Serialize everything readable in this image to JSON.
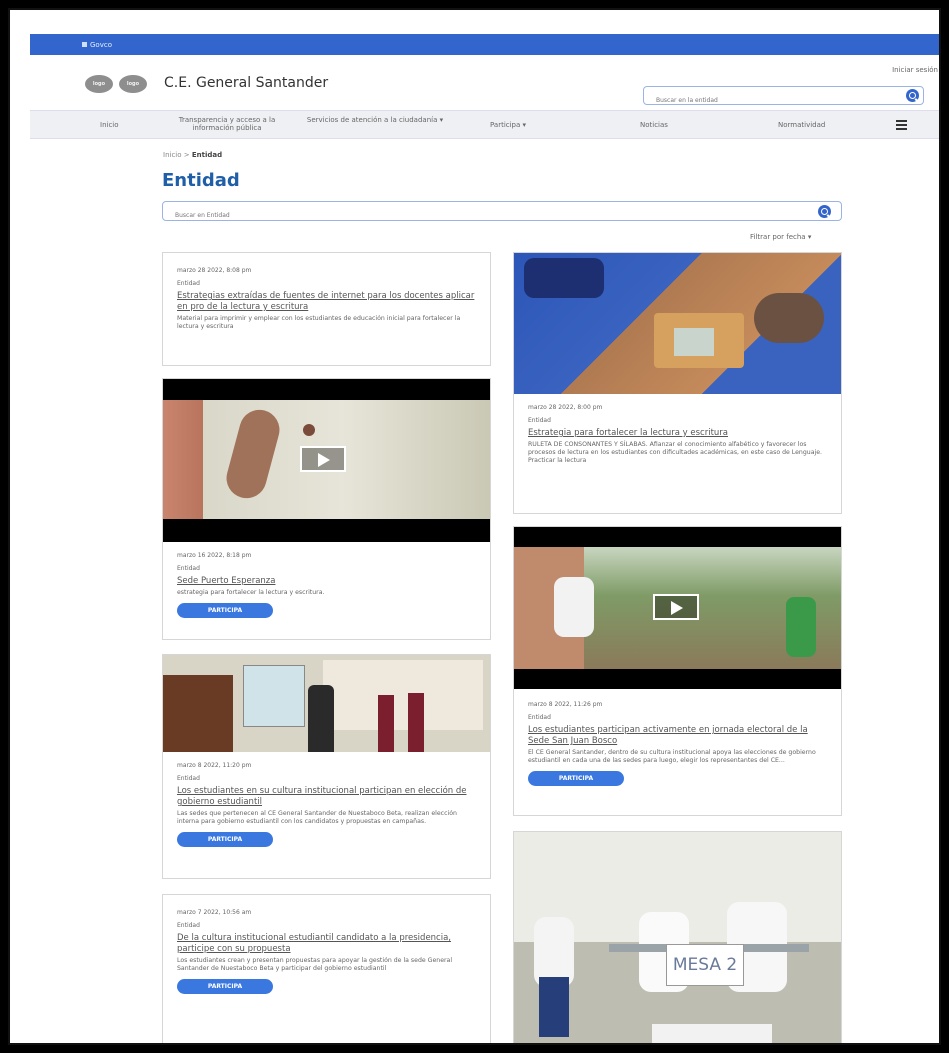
{
  "header": {
    "topbar_label": "Govco",
    "logo1": "logo",
    "logo2": "logo",
    "site_title": "C.E. General Santander",
    "login": "Iniciar sesión",
    "search_placeholder": "Buscar en la entidad"
  },
  "nav": {
    "items": [
      "Inicio",
      "Transparencia y acceso a la información pública",
      "Servicios de atención a la ciudadanía ▾",
      "Participa ▾",
      "Noticias",
      "Normatividad"
    ]
  },
  "breadcrumb": {
    "home": "Inicio",
    "sep": ">",
    "current": "Entidad"
  },
  "page": {
    "title": "Entidad",
    "search_placeholder": "Buscar en Entidad",
    "filter": "Filtrar por fecha ▾"
  },
  "cards": [
    {
      "date": "marzo 28 2022, 8:08 pm",
      "tag": "Entidad",
      "title": "Estrategias extraídas de fuentes de internet para los docentes aplicar en pro de la lectura y escritura",
      "desc": "Material para imprimir y emplear con los estudiantes de educación inicial para fortalecer la lectura y escritura"
    },
    {
      "date": "marzo 28 2022, 8:00 pm",
      "tag": "Entidad",
      "title": "Estrategia para fortalecer la lectura y escritura",
      "desc": "RULETA DE CONSONANTES Y SÍLABAS. Afianzar el conocimiento alfabético y favorecer los procesos de lectura en los estudiantes con dificultades académicas, en este caso de Lenguaje. Practicar la lectura"
    },
    {
      "date": "marzo 16 2022, 8:18 pm",
      "tag": "Entidad",
      "title": "Sede Puerto Esperanza",
      "desc": "estrategia para fortalecer la lectura y escritura.",
      "button": "PARTICIPA"
    },
    {
      "date": "marzo 8 2022, 11:26 pm",
      "tag": "Entidad",
      "title": "Los estudiantes participan activamente en jornada electoral de la Sede San Juan Bosco",
      "desc": "El CE General Santander, dentro de su cultura institucional apoya las elecciones de gobierno estudiantil en cada una de las sedes para luego, elegir los representantes del CE...",
      "button": "PARTICIPA"
    },
    {
      "date": "marzo 8 2022, 11:20 pm",
      "tag": "Entidad",
      "title": "Los estudiantes en su cultura institucional participan en elección de gobierno estudiantil",
      "desc": "Las sedes que pertenecen al CE General Santander de Nuestaboco Beta, realizan elección interna para gobierno estudiantil con los candidatos y propuestas en campañas.",
      "button": "PARTICIPA"
    },
    {
      "date": "marzo 7 2022, 10:56 am",
      "tag": "Entidad",
      "title": "De la cultura institucional estudiantil candidato a la presidencia, participe con su propuesta",
      "desc": "Los estudiantes crean y presentan propuestas para apoyar la gestión de la sede General Santander de Nuestaboco Beta y participar del gobierno estudiantil",
      "button": "PARTICIPA"
    }
  ],
  "photo_signs": {
    "mesa": "MESA 2"
  },
  "colors": {
    "brand_blue": "#3366cc",
    "title_blue": "#1f5fa8",
    "button_blue": "#3a78e0"
  }
}
